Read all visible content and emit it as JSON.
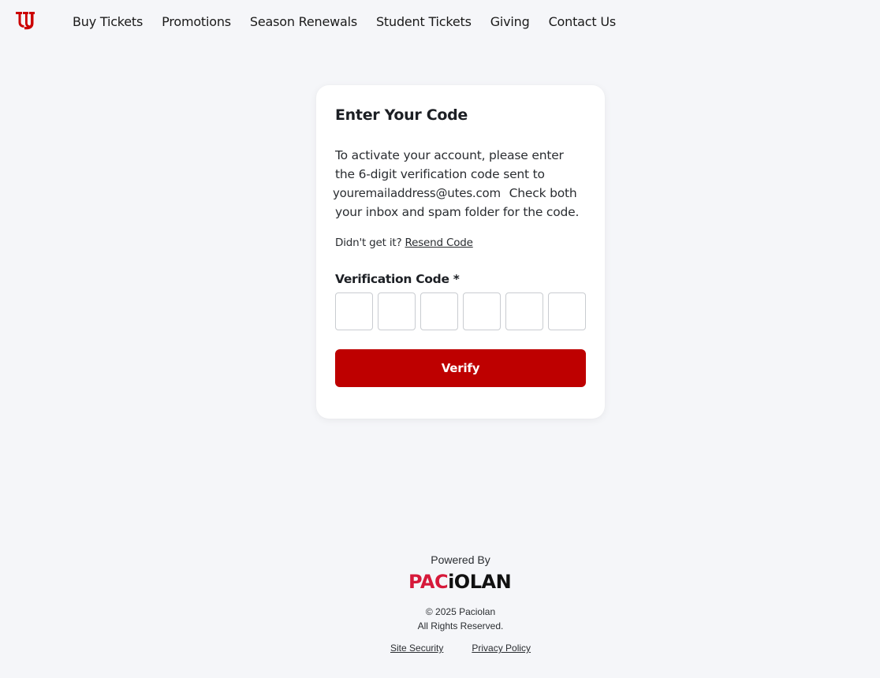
{
  "brand": {
    "logo_icon": "utah-u-logo-icon",
    "accent": "#be0000",
    "logo_color": "#cc0000"
  },
  "nav": {
    "items": [
      {
        "label": "Buy Tickets"
      },
      {
        "label": "Promotions"
      },
      {
        "label": "Season Renewals"
      },
      {
        "label": "Student Tickets"
      },
      {
        "label": "Giving"
      },
      {
        "label": "Contact Us"
      }
    ]
  },
  "card": {
    "title": "Enter Your Code",
    "desc_line1": "To activate your account, please enter the 6-digit verification code sent to",
    "email": "youremailaddress@utes.com",
    "desc_line2": "Check both your inbox and spam folder for the code.",
    "resend_prompt": "Didn't get it?",
    "resend_link": "Resend Code",
    "field_label": "Verification Code *",
    "code_digits": [
      "",
      "",
      "",
      "",
      "",
      ""
    ],
    "verify_label": "Verify"
  },
  "footer": {
    "powered_by": "Powered By",
    "brand_part1": "PAC",
    "brand_part2": "iOLAN",
    "brand_red": "#d6193a",
    "copyright_line1": "© 2025 Paciolan",
    "copyright_line2": "All Rights Reserved.",
    "links": [
      {
        "label": "Site Security"
      },
      {
        "label": "Privacy Policy"
      }
    ]
  }
}
